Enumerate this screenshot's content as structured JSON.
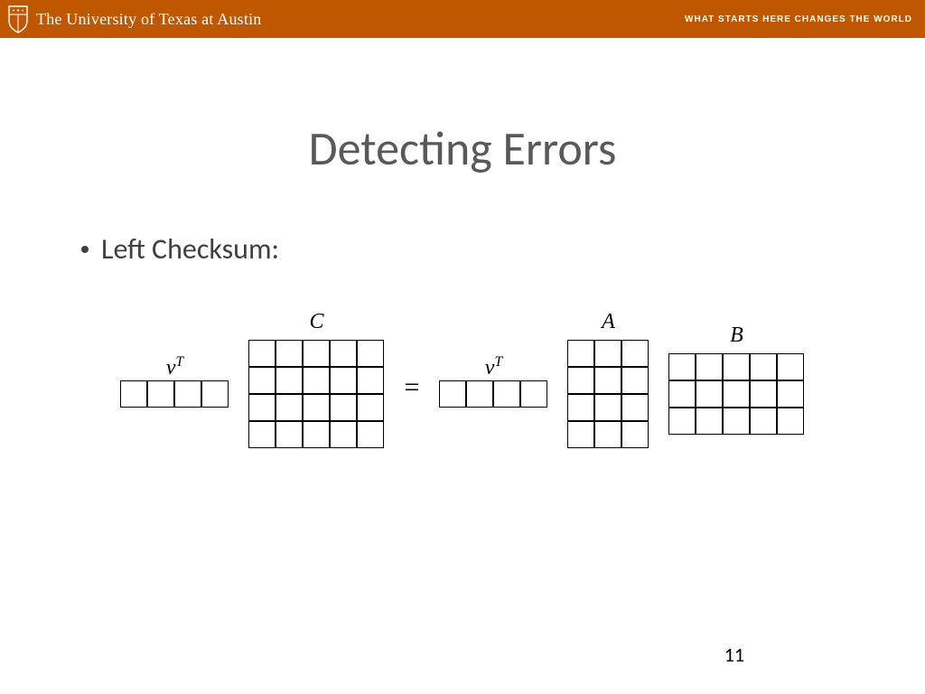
{
  "banner": {
    "university": "The University of Texas at Austin",
    "slogan": "WHAT STARTS HERE CHANGES THE WORLD"
  },
  "slide": {
    "title": "Detecting Errors",
    "bullet": "Left Checksum:",
    "pagenum": "11"
  },
  "eq": {
    "vT": "v",
    "vT_sup": "T",
    "C": "C",
    "A": "A",
    "B": "B",
    "equals": "="
  },
  "matrices": {
    "vT_left": {
      "rows": 1,
      "cols": 4
    },
    "C": {
      "rows": 4,
      "cols": 5
    },
    "vT_right": {
      "rows": 1,
      "cols": 4
    },
    "A": {
      "rows": 4,
      "cols": 3
    },
    "B": {
      "rows": 3,
      "cols": 5
    }
  }
}
